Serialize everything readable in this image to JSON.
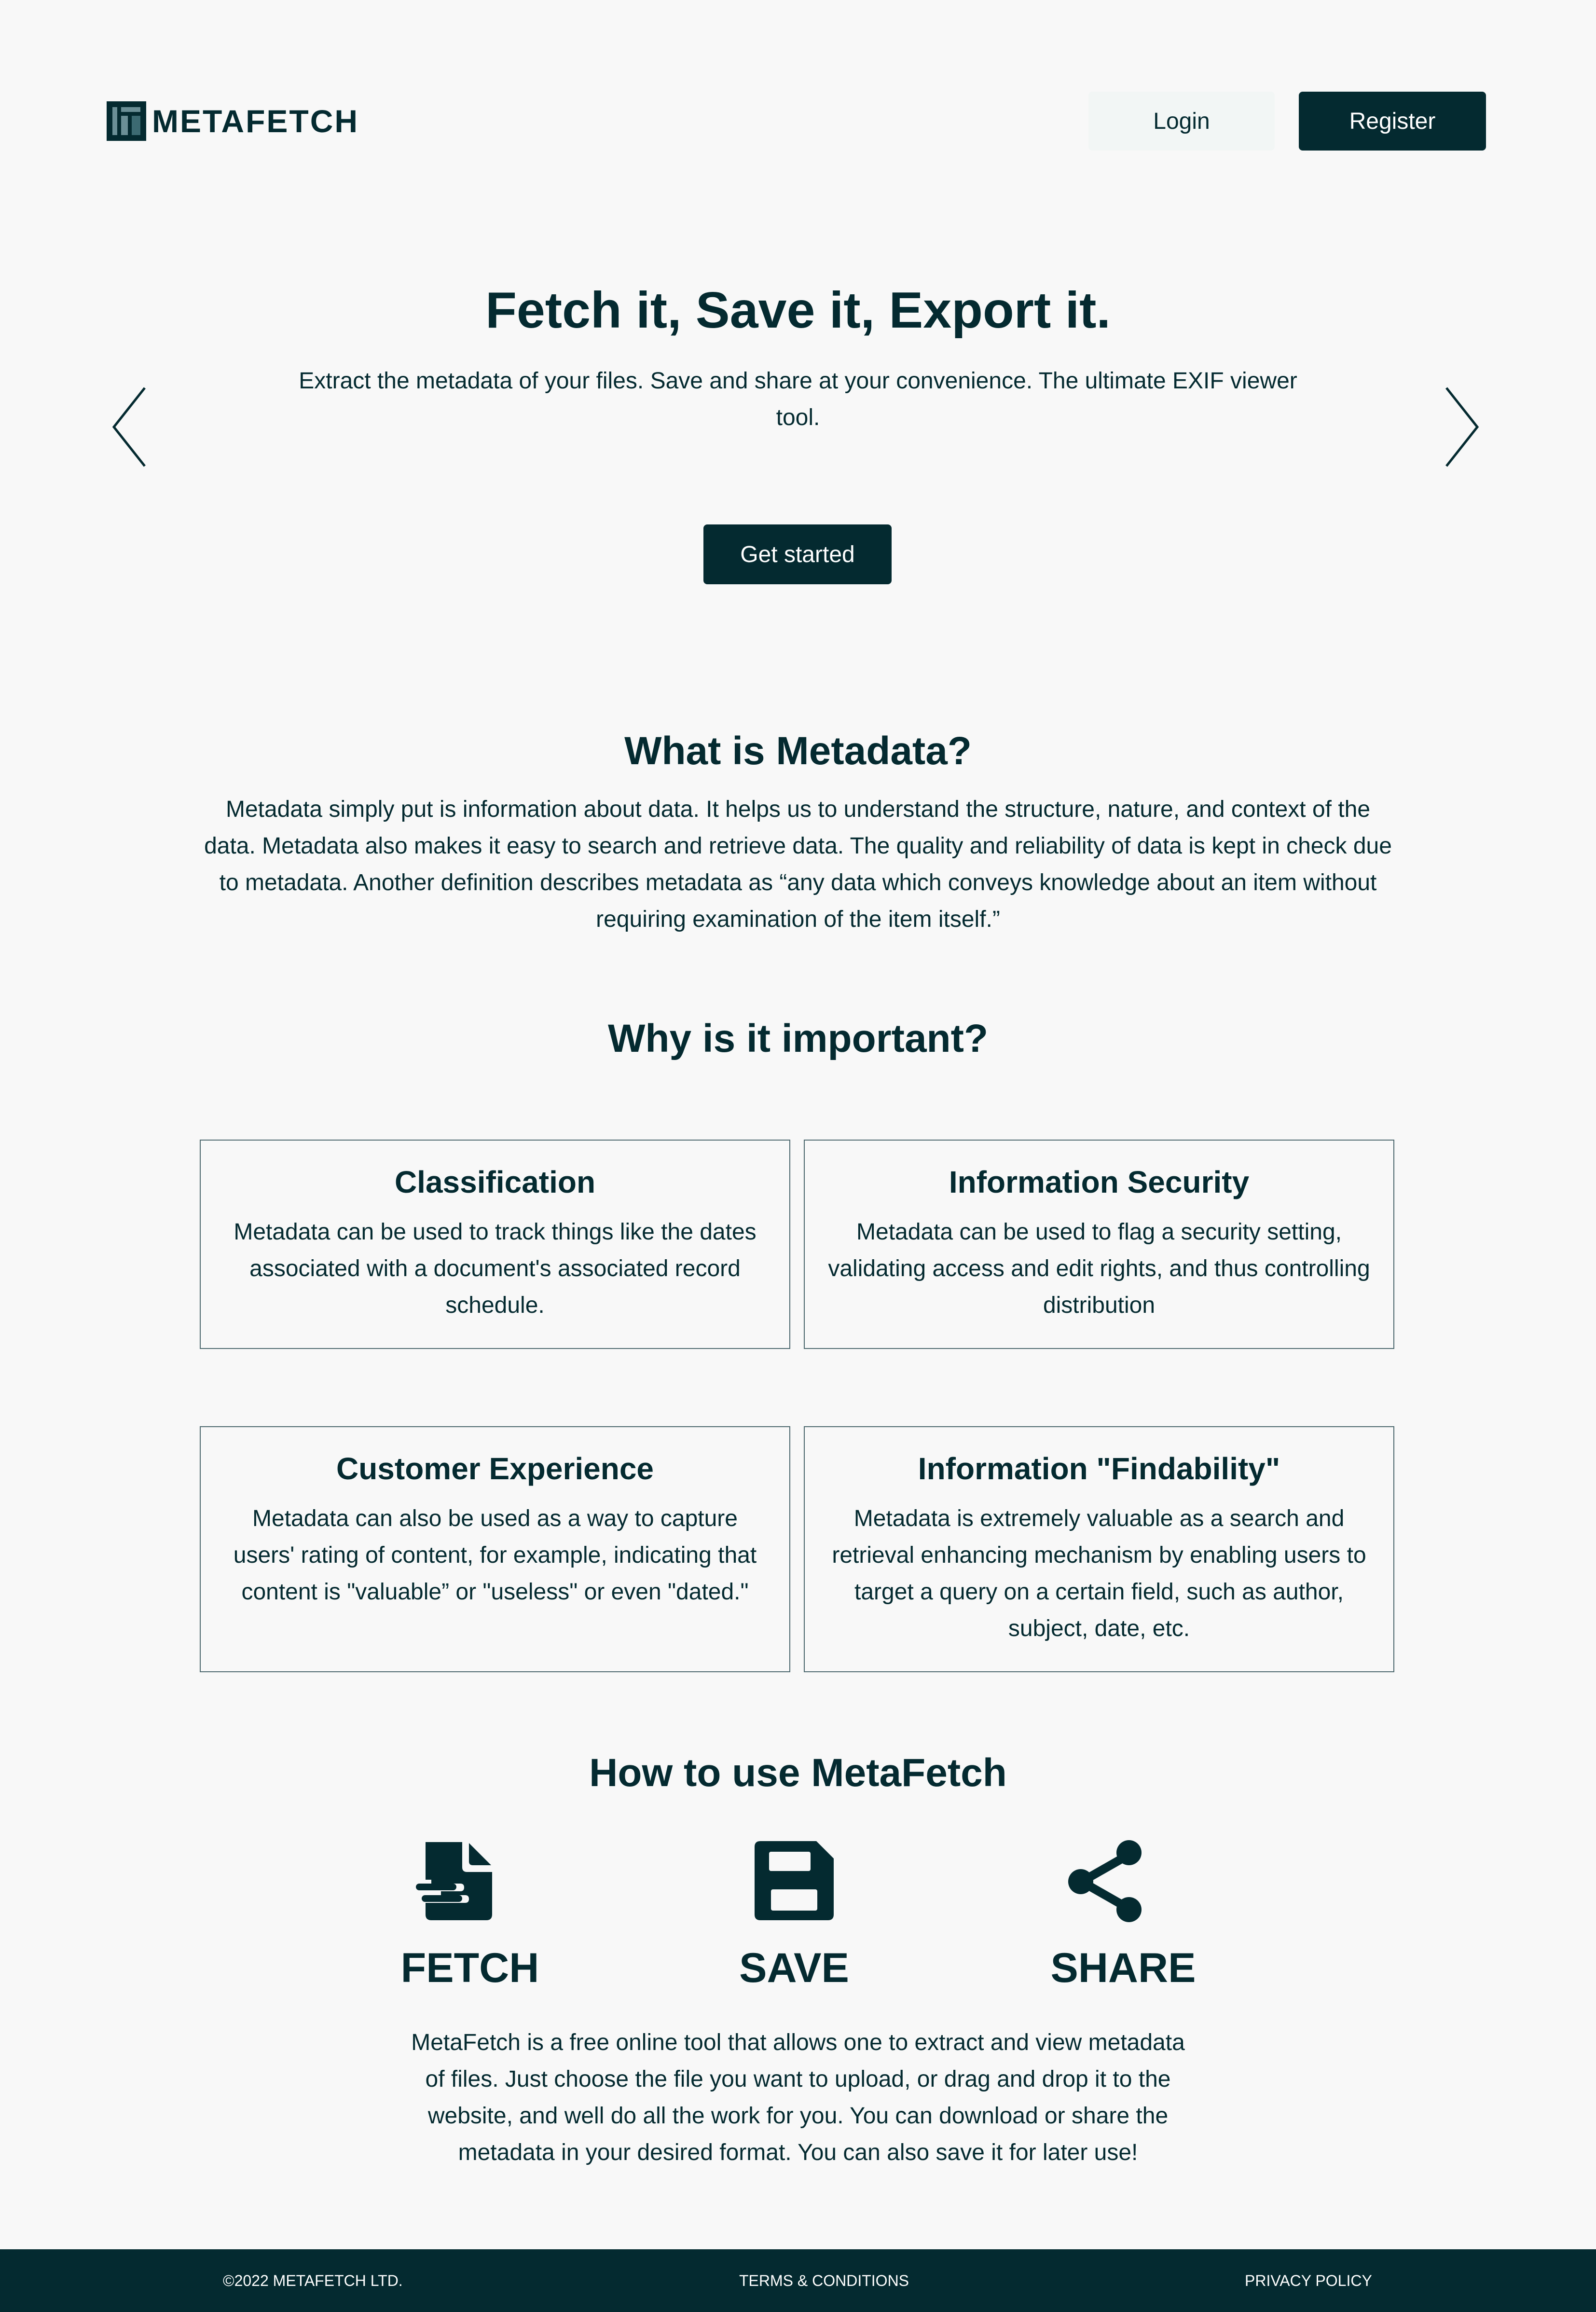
{
  "header": {
    "logo_text": "METAFETCH",
    "login_label": "Login",
    "register_label": "Register"
  },
  "hero": {
    "title": "Fetch it, Save it, Export it.",
    "subtitle": "Extract the metadata of your files. Save and share at your convenience. The ultimate EXIF viewer tool.",
    "cta_label": "Get started",
    "prev_icon": "chevron-left-icon",
    "next_icon": "chevron-right-icon"
  },
  "metadata_section": {
    "title": "What is Metadata?",
    "body": "Metadata simply put is information about data. It helps us to understand the structure, nature, and context of the data. Metadata also makes it easy to search and retrieve data. The quality and reliability of data is kept in check due to metadata. Another definition describes metadata as “any data which conveys knowledge about an item without requiring examination of the item itself.”"
  },
  "importance_section": {
    "title": "Why is it important?",
    "cards": [
      {
        "title": "Classification",
        "body": "Metadata can be used to track things like the dates associated with a document's associated record schedule."
      },
      {
        "title": "Information Security",
        "body": "Metadata can be used to flag a security setting, validating access and edit rights, and thus controlling distribution"
      },
      {
        "title": "Customer Experience",
        "body": "Metadata can also be used as a way to capture users' rating of content, for example, indicating that content is \"valuable” or \"useless\" or even \"dated.\""
      },
      {
        "title": "Information \"Findability\"",
        "body": "Metadata is extremely valuable as a search and retrieval enhancing mechanism by enabling users to target a query on a certain field, such as author, subject, date, etc."
      }
    ]
  },
  "howto_section": {
    "title": "How to use MetaFetch",
    "steps": [
      {
        "label": "FETCH",
        "icon": "file-icon"
      },
      {
        "label": "SAVE",
        "icon": "floppy-disk-icon"
      },
      {
        "label": "SHARE",
        "icon": "share-icon"
      }
    ],
    "body": "MetaFetch is a free online tool that allows one to extract and view metadata of files. Just choose the file you want to upload, or drag and drop it to the website, and well do all the work for you. You can download or share the metadata in your desired format. You can also save it for later use!"
  },
  "footer": {
    "copyright": "©2022 METAFETCH LTD.",
    "terms": "TERMS & CONDITIONS",
    "privacy": "PRIVACY POLICY"
  },
  "colors": {
    "primary": "#042a30",
    "background": "#f8f8f8",
    "card_border": "#4f6a70"
  }
}
